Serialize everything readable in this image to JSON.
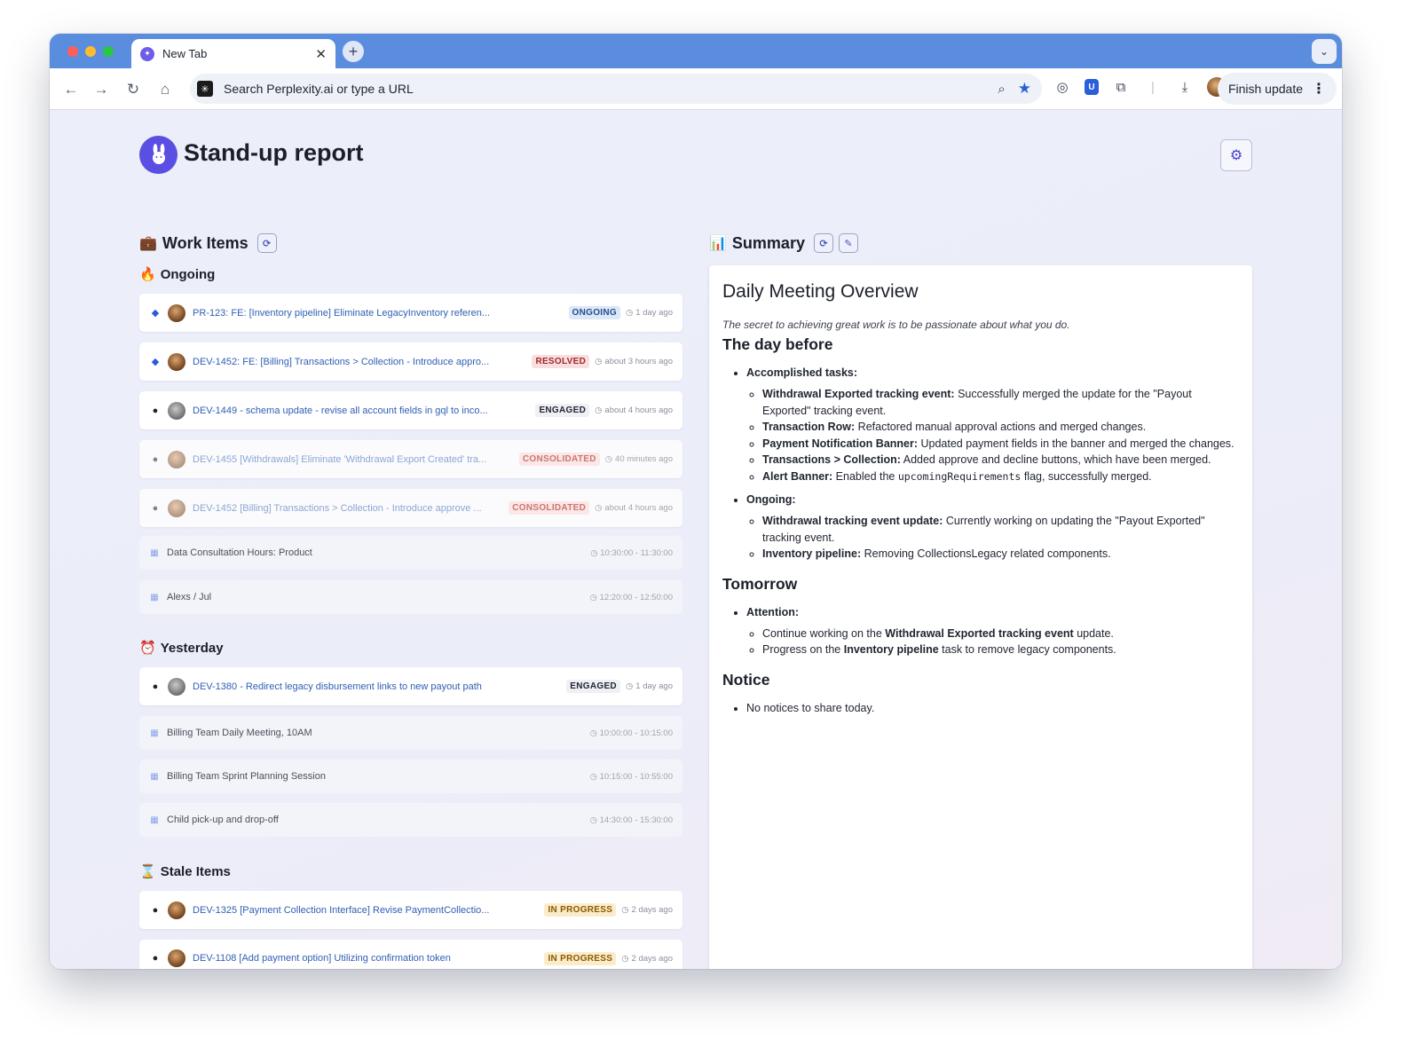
{
  "browser": {
    "tab_title": "New Tab",
    "omnibox_placeholder": "Search Perplexity.ai or type a URL",
    "finish_update": "Finish update"
  },
  "header": {
    "title": "Stand-up report"
  },
  "work_items": {
    "heading": "Work Items",
    "ongoing_label": "Ongoing",
    "yesterday_label": "Yesterday",
    "stale_label": "Stale Items",
    "ongoing": [
      {
        "title": "PR-123: FE: [Inventory pipeline] Eliminate LegacyInventory referen...",
        "status": "ONGOING",
        "time": "1 day ago"
      },
      {
        "title": "DEV-1452: FE: [Billing] Transactions > Collection - Introduce appro...",
        "status": "RESOLVED",
        "time": "about 3 hours ago"
      },
      {
        "title": "DEV-1449 - schema update - revise all account fields in gql to inco...",
        "status": "ENGAGED",
        "time": "about 4 hours ago"
      },
      {
        "title": "DEV-1455 [Withdrawals] Eliminate 'Withdrawal Export Created' tra...",
        "status": "CONSOLIDATED",
        "time": "40 minutes ago"
      },
      {
        "title": "DEV-1452 [Billing] Transactions > Collection - Introduce approve ...",
        "status": "CONSOLIDATED",
        "time": "about 4 hours ago"
      }
    ],
    "ongoing_events": [
      {
        "title": "Data Consultation Hours: Product",
        "time": "10:30:00 - 11:30:00"
      },
      {
        "title": "Alexs / Jul",
        "time": "12:20:00 - 12:50:00"
      }
    ],
    "yesterday": [
      {
        "title": "DEV-1380 - Redirect legacy disbursement links to new payout path",
        "status": "ENGAGED",
        "time": "1 day ago"
      }
    ],
    "yesterday_events": [
      {
        "title": "Billing Team Daily Meeting, 10AM",
        "time": "10:00:00 - 10:15:00"
      },
      {
        "title": "Billing Team Sprint Planning Session",
        "time": "10:15:00 - 10:55:00"
      },
      {
        "title": "Child pick-up and drop-off",
        "time": "14:30:00 - 15:30:00"
      }
    ],
    "stale": [
      {
        "title": "DEV-1325 [Payment Collection Interface] Revise PaymentCollectio...",
        "status": "IN PROGRESS",
        "time": "2 days ago"
      },
      {
        "title": "DEV-1108 [Add payment option] Utilizing confirmation token",
        "status": "IN PROGRESS",
        "time": "2 days ago"
      }
    ]
  },
  "summary": {
    "heading": "Summary",
    "title": "Daily Meeting Overview",
    "quote": "The secret to achieving great work is to be passionate about what you do.",
    "day_before_heading": "The day before",
    "accomplished_label": "Accomplished tasks:",
    "accomplished": [
      {
        "bold": "Withdrawal Exported tracking event:",
        "text": " Successfully merged the update for the \"Payout Exported\" tracking event."
      },
      {
        "bold": "Transaction Row:",
        "text": " Refactored manual approval actions and merged changes."
      },
      {
        "bold": "Payment Notification Banner:",
        "text": " Updated payment fields in the banner and merged the changes."
      },
      {
        "bold": "Transactions > Collection:",
        "text": " Added approve and decline buttons, which have been merged."
      }
    ],
    "alert_bold": "Alert Banner:",
    "alert_pre": " Enabled the ",
    "alert_code": "upcomingRequirements",
    "alert_post": " flag, successfully merged.",
    "ongoing_label": "Ongoing:",
    "ongoing": [
      {
        "bold": "Withdrawal tracking event update:",
        "text": " Currently working on updating the \"Payout Exported\" tracking event."
      },
      {
        "bold": "Inventory pipeline:",
        "text": " Removing CollectionsLegacy related components."
      }
    ],
    "tomorrow_heading": "Tomorrow",
    "attention_label": "Attention:",
    "attention_1_pre": "Continue working on the ",
    "attention_1_bold": "Withdrawal Exported tracking event",
    "attention_1_post": " update.",
    "attention_2_pre": "Progress on the ",
    "attention_2_bold": "Inventory pipeline",
    "attention_2_post": " task to remove legacy components.",
    "notice_heading": "Notice",
    "notice_item": "No notices to share today."
  }
}
